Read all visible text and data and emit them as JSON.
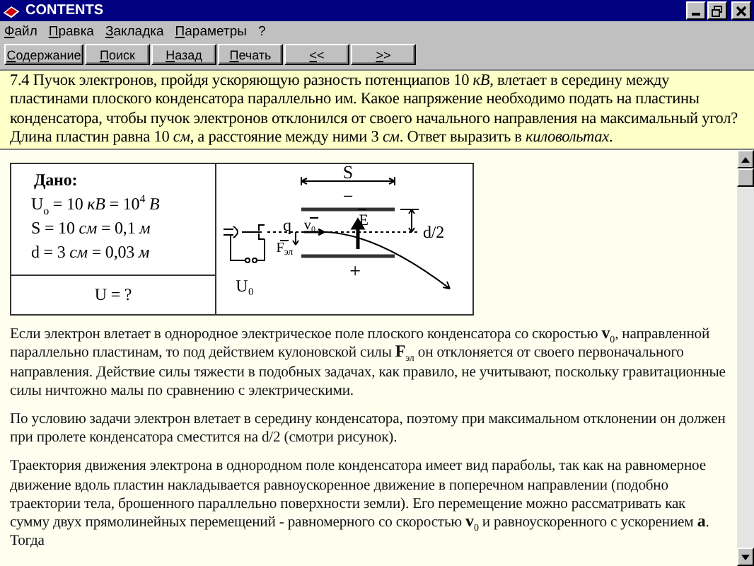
{
  "window": {
    "title": "CONTENTS"
  },
  "menu": [
    "Файл",
    "Правка",
    "Закладка",
    "Параметры",
    "?"
  ],
  "toolbar": [
    "Содержание",
    "Поиск",
    "Назад",
    "Печать",
    "<<",
    ">>"
  ],
  "header": "7.4 Пучок электронов, пройдя ускоряющую разность потенциапов 10 *кВ*, влетает в середину между пластинами плоского конденсатора параллельно им. Какое напряжение необходимо подать на пластины конденсатора, чтобы пучок электронов отклонился от своего начального направления на максимальный угол? Длина пластин равна 10 *см*, а расстояние между ними 3 *см*. Ответ выразить в *киловольтах*.",
  "given": {
    "title": "Дано:",
    "lines": [
      "U$_{o}$ = 10 *кВ* = 10$^{4}$ *В*",
      "S = 10 *см* = 0,1 *м*",
      "d = 3 *см* = 0,03 *м*"
    ],
    "unknown": "U = ?"
  },
  "diagram": {
    "labels": [
      "S",
      "−",
      "+",
      "q",
      "v₀",
      "E",
      "F",
      "эл",
      "d/2",
      "U₀"
    ]
  },
  "paragraphs": [
    "Если электрон влетает в однородное электрическое поле плоского конденсатора со скоростью **v**$_{0}$, направленной параллельно пластинам, то под действием кулоновской силы **F**$_{эл}$ он отклоняется от своего первоначального направления. Действие силы тяжести в подобных задачах, как правило, не учитывают, поскольку гравитационные силы ничтожно малы по сравнению с электрическими.",
    "По условию задачи электрон влетает в середину конденсатора, поэтому при максимальном отклонении он должен при пролете конденсатора сместится на d/2 (смотри рисунок).",
    "Траектория движения электрона в однородном поле конденсатора имеет вид параболы, так как на равномерное движение вдоль пластин накладывается равноускоренное движение в поперечном направлении (подобно траектории тела, брошенного параллельно поверхности земли). Его перемещение можно рассматривать как сумму двух прямолинейных перемещений - равномерного  со скоростью **v**$_{0}$ и равноускоренного с ускорением **a**. Тогда"
  ]
}
